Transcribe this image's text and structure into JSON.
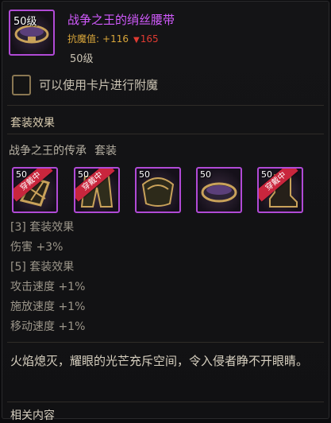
{
  "item": {
    "icon_level": "50级",
    "name": "战争之王的绡丝腰带",
    "stat_label": "抗魔值:",
    "stat_value": "+116",
    "stat_down": "165",
    "level": "50级"
  },
  "card": {
    "text": "可以使用卡片进行附魔"
  },
  "set": {
    "section_title": "套装效果",
    "name": "战争之王的传承",
    "suffix": "套装",
    "items": [
      {
        "level": "50",
        "equipped": "穿戴中",
        "icon": "gauntlet-icon"
      },
      {
        "level": "50",
        "equipped": "穿戴中",
        "icon": "pants-icon"
      },
      {
        "level": "50",
        "equipped": "",
        "icon": "shoulder-icon"
      },
      {
        "level": "50",
        "equipped": "",
        "icon": "belt-icon"
      },
      {
        "level": "50",
        "equipped": "穿戴中",
        "icon": "boots-icon"
      }
    ]
  },
  "effects": [
    "[3] 套装效果",
    "伤害 +3%",
    "[5] 套装效果",
    "攻击速度 +1%",
    "施放速度 +1%",
    "移动速度 +1%"
  ],
  "flavor_text": "火焰熄灭，耀眼的光芒充斥空间，令入侵者睁不开眼睛。",
  "related": "相关内容",
  "colors": {
    "epic": "#b14ad6",
    "name": "#d35bff",
    "stat": "#d9a63a",
    "down": "#e03b32"
  }
}
